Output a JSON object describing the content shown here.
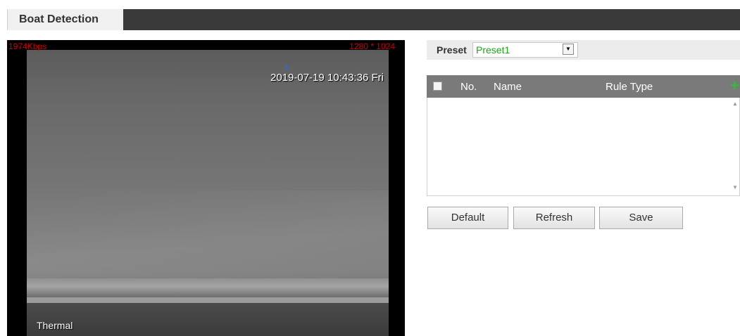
{
  "tab": {
    "title": "Boat Detection"
  },
  "video": {
    "bitrate": "1974Kbps",
    "resolution": "1280 * 1024",
    "timestamp": "2019-07-19 10:43:36 Fri",
    "channel_label": "Thermal"
  },
  "preset": {
    "label": "Preset",
    "value": "Preset1"
  },
  "rules_table": {
    "columns": {
      "no": "No.",
      "name": "Name",
      "rule_type": "Rule Type"
    },
    "rows": []
  },
  "buttons": {
    "default": "Default",
    "refresh": "Refresh",
    "save": "Save"
  },
  "colors": {
    "accent_green": "#1aa71a",
    "osd_red": "#cc0000",
    "header_gray": "#7a7a7a"
  },
  "icons": {
    "add": "plus-icon",
    "dropdown": "chevron-down-icon"
  }
}
